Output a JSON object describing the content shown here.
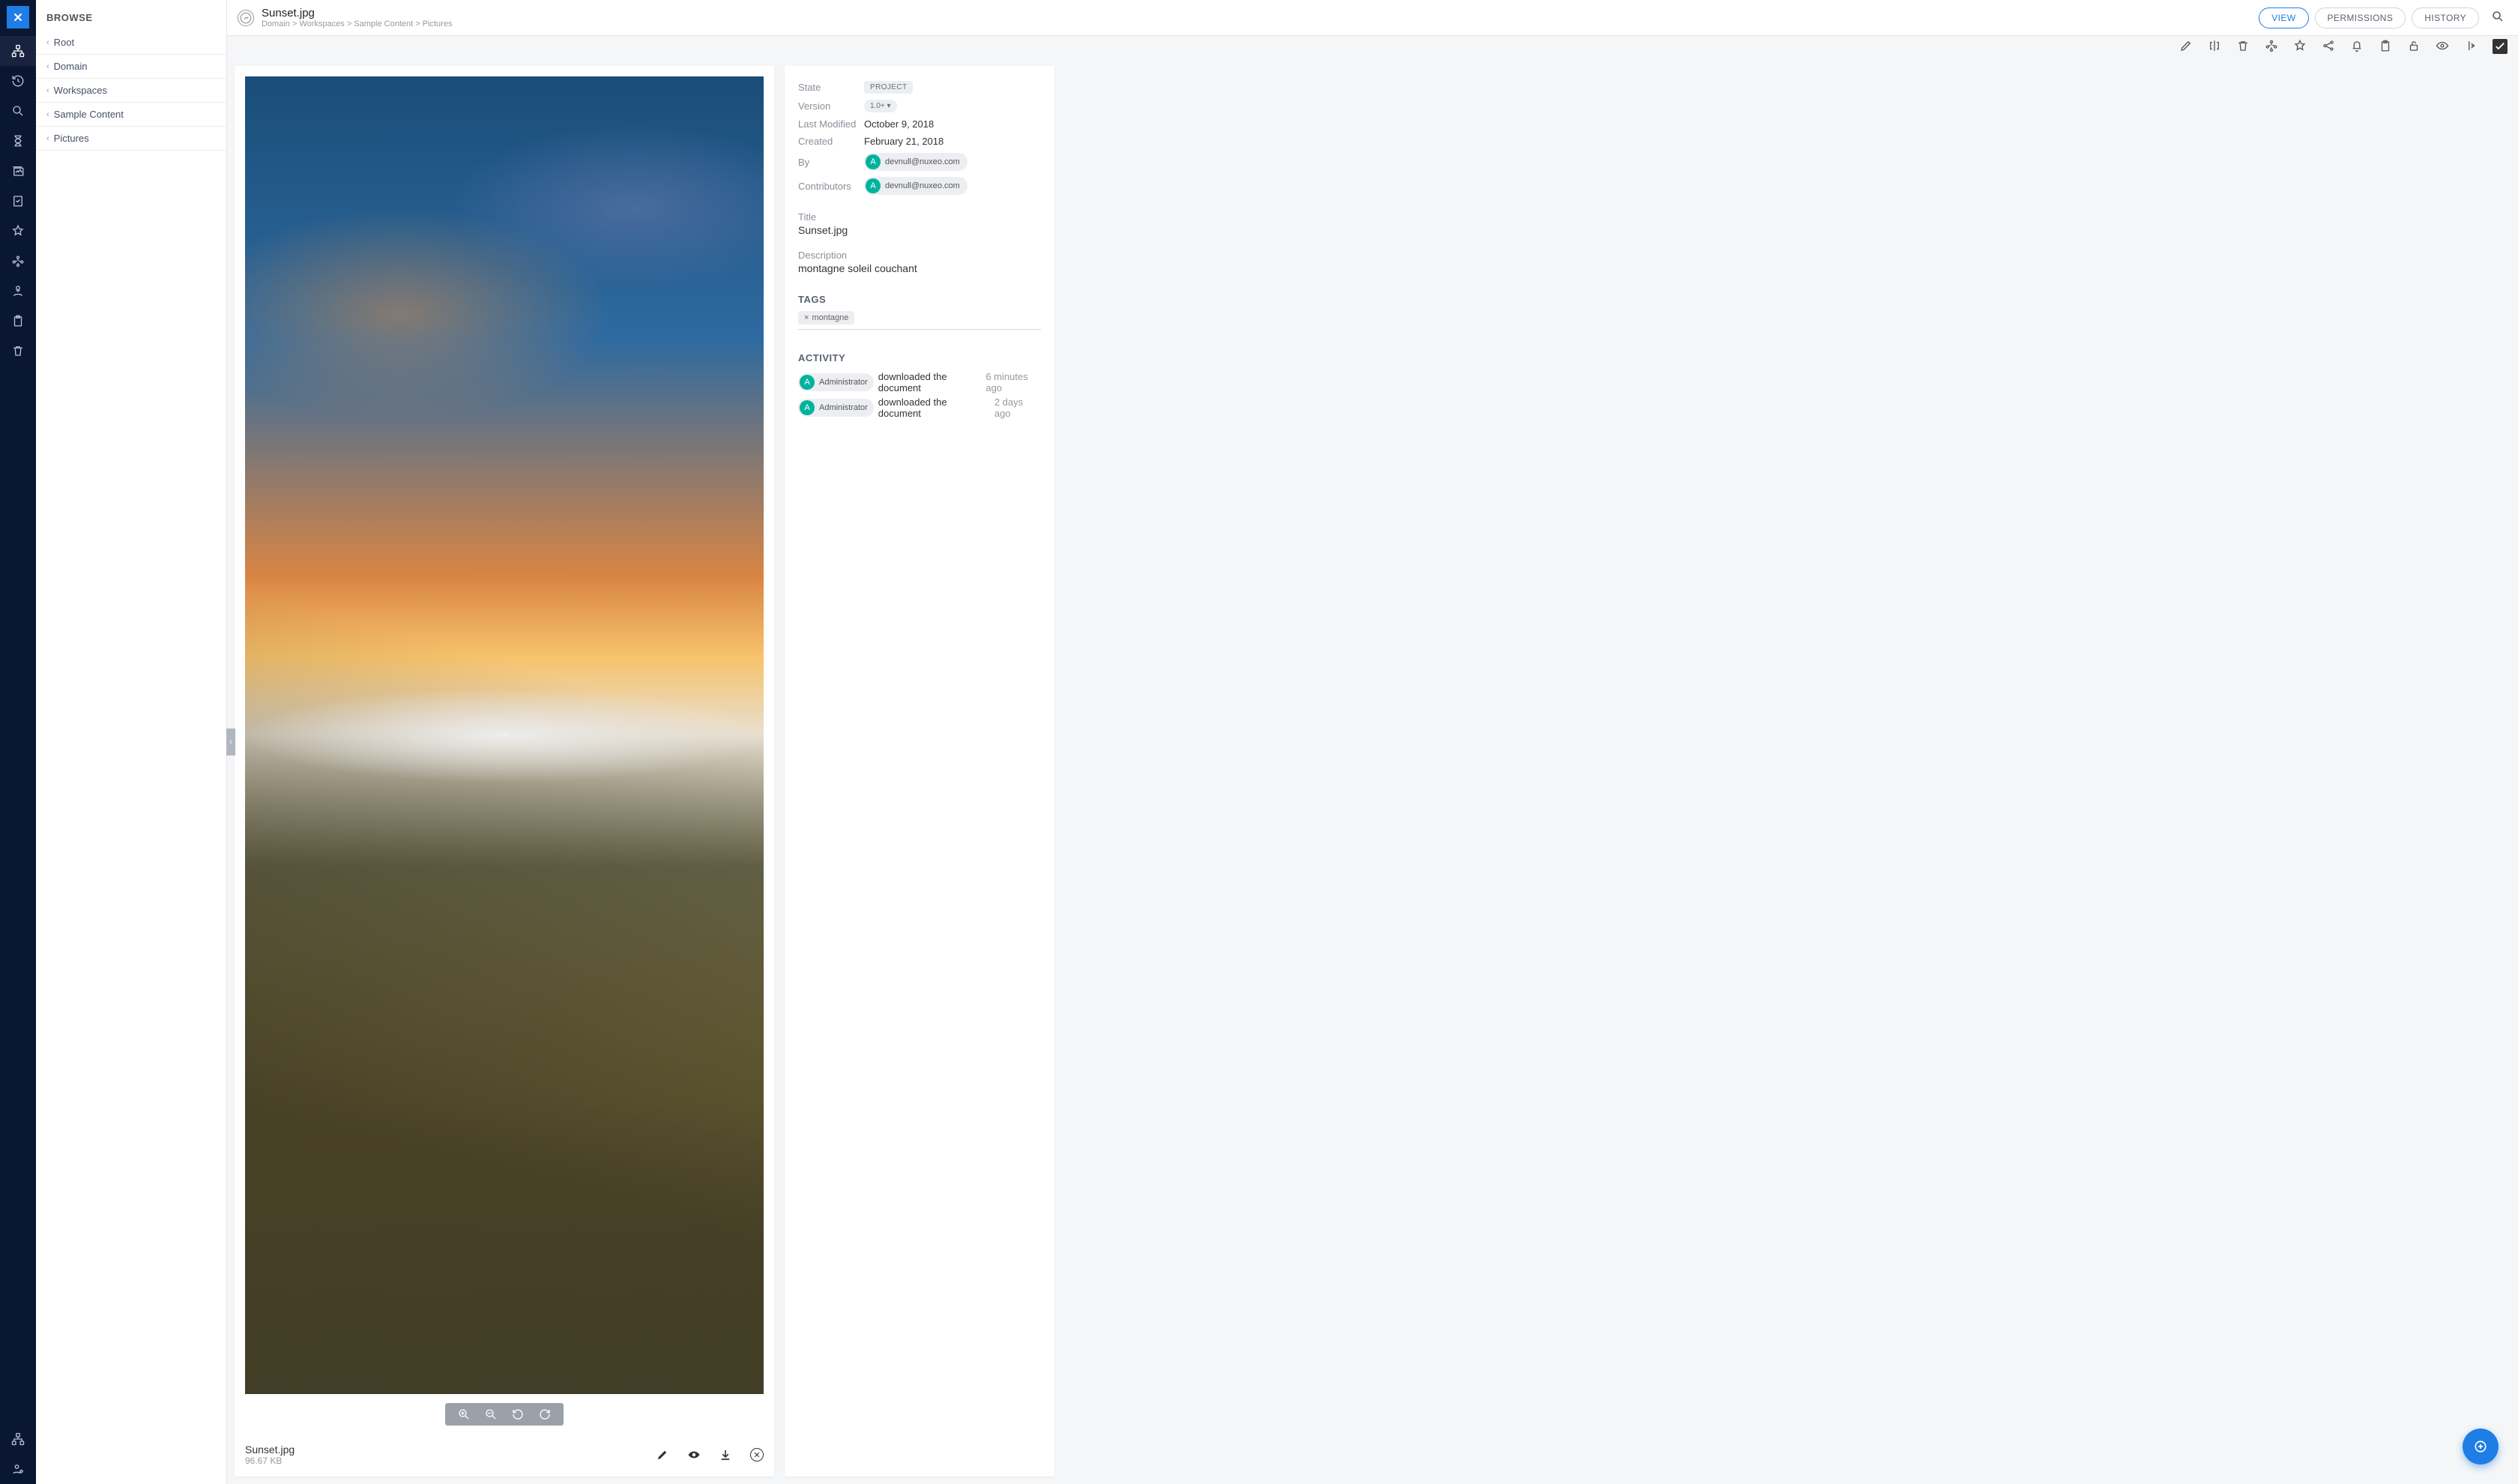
{
  "sidebar": {
    "header": "BROWSE",
    "items": [
      "Root",
      "Domain",
      "Workspaces",
      "Sample Content",
      "Pictures"
    ]
  },
  "doc": {
    "title": "Sunset.jpg",
    "breadcrumb": "Domain > Workspaces > Sample Content > Pictures"
  },
  "tabs": {
    "view": "VIEW",
    "permissions": "PERMISSIONS",
    "history": "HISTORY"
  },
  "info": {
    "state_label": "State",
    "state_value": "PROJECT",
    "version_label": "Version",
    "version_value": "1.0+",
    "modified_label": "Last Modified",
    "modified_value": "October 9, 2018",
    "created_label": "Created",
    "created_value": "February 21, 2018",
    "by_label": "By",
    "by_user": "devnull@nuxeo.com",
    "by_initial": "A",
    "contrib_label": "Contributors",
    "contrib_user": "devnull@nuxeo.com",
    "contrib_initial": "A",
    "title_label": "Title",
    "title_value": "Sunset.jpg",
    "desc_label": "Description",
    "desc_value": "montagne soleil couchant",
    "tags_header": "TAGS",
    "tag0": "montagne",
    "activity_header": "ACTIVITY"
  },
  "activity": [
    {
      "initial": "A",
      "who": "Administrator",
      "action": "downloaded the document",
      "when": "6 minutes ago"
    },
    {
      "initial": "A",
      "who": "Administrator",
      "action": "downloaded the document",
      "when": "2 days ago"
    }
  ],
  "file": {
    "name": "Sunset.jpg",
    "size": "96.67 KB"
  }
}
